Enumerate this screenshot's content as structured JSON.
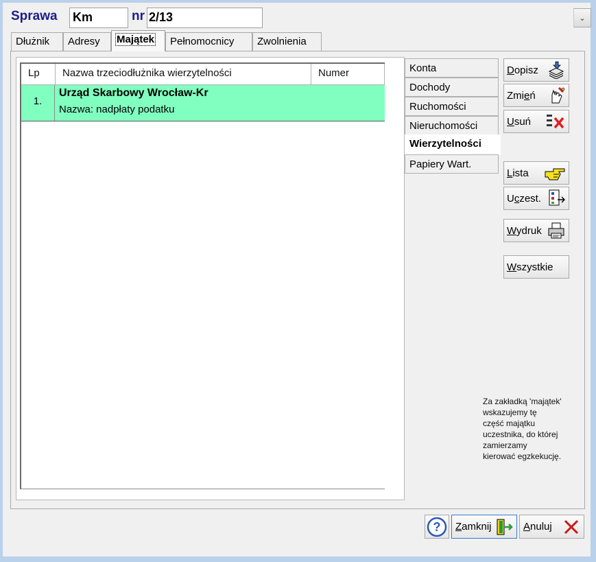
{
  "header": {
    "sprawa_label": "Sprawa",
    "repertorium_value": "Km",
    "nr_label": "nr",
    "nr_value": "2/13"
  },
  "tabs": [
    {
      "label": "Dłużnik",
      "active": false
    },
    {
      "label": "Adresy",
      "active": false
    },
    {
      "label": "Majątek",
      "active": true
    },
    {
      "label": "Pełnomocnicy",
      "active": false
    },
    {
      "label": "Zwolnienia",
      "active": false
    }
  ],
  "table": {
    "columns": [
      "Lp",
      "Nazwa trzeciodłużnika wierzytelności",
      "Numer"
    ],
    "rows": [
      {
        "lp": "1.",
        "name": "Urząd Skarbowy Wrocław-Kr",
        "detail": "Nazwa:  nadpłaty podatku",
        "numer": ""
      }
    ],
    "highlight_color": "#80ffc0"
  },
  "asset_tabs": [
    {
      "label": "Konta",
      "active": false
    },
    {
      "label": "Dochody",
      "active": false
    },
    {
      "label": "Ruchomości",
      "active": false
    },
    {
      "label": "Nieruchomości",
      "active": false
    },
    {
      "label": "Wierzytelności",
      "active": true
    },
    {
      "label": "Papiery Wart.",
      "active": false
    }
  ],
  "actions": {
    "dopisz": {
      "key": "D",
      "rest": "opisz",
      "icon": "stack-add-icon"
    },
    "zmien": {
      "pre": "Zmi",
      "key": "e",
      "rest": "ń",
      "icon": "edit-hand-icon"
    },
    "usun": {
      "key": "U",
      "rest": "suń",
      "icon": "delete-x-icon"
    },
    "lista": {
      "key": "L",
      "rest": "ista",
      "icon": "pointing-hand-icon"
    },
    "uczest": {
      "pre": "U",
      "key": "c",
      "rest": "zest.",
      "icon": "participants-icon"
    },
    "wydruk": {
      "key": "W",
      "rest": "ydruk",
      "icon": "printer-icon"
    },
    "wszystkie": {
      "key": "W",
      "rest": "szystkie"
    }
  },
  "note": {
    "lines": [
      "Za zakładką 'majątek'",
      "wskazujemy tę",
      "część majątku",
      "uczestnika, do której",
      "zamierzamy",
      "kierować egzkekucję."
    ]
  },
  "footer": {
    "help_icon": "help-icon",
    "zamknij": {
      "key": "Z",
      "rest": "amknij",
      "icon": "exit-door-icon"
    },
    "anuluj": {
      "key": "A",
      "rest": "nuluj",
      "icon": "cancel-x-icon"
    }
  }
}
